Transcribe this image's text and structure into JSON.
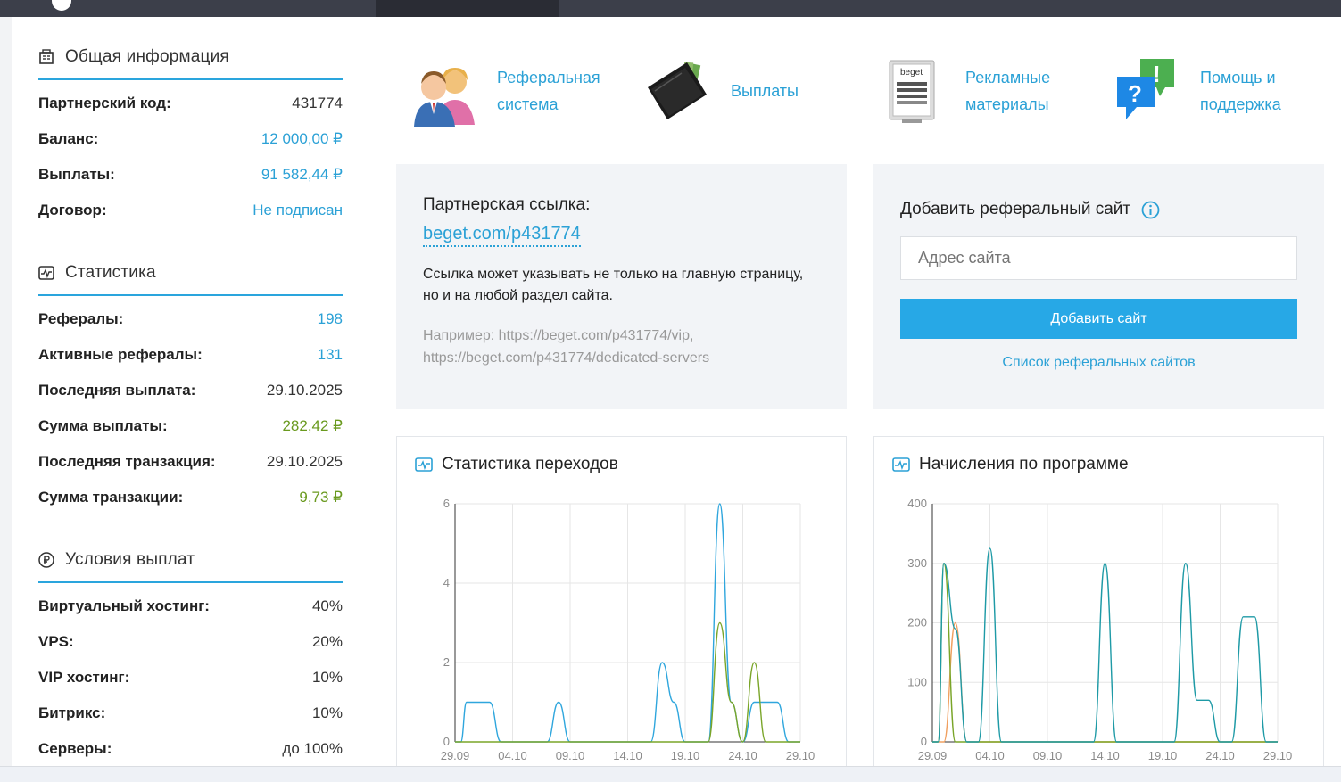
{
  "general": {
    "title": "Общая информация",
    "rows": [
      {
        "label": "Партнерский код:",
        "value": "431774",
        "style": "plain"
      },
      {
        "label": "Баланс:",
        "value": "12 000,00 ₽",
        "style": "blue"
      },
      {
        "label": "Выплаты:",
        "value": "91 582,44 ₽",
        "style": "blue"
      },
      {
        "label": "Договор:",
        "value": "Не подписан",
        "style": "blue"
      }
    ]
  },
  "stats": {
    "title": "Статистика",
    "rows": [
      {
        "label": "Рефералы:",
        "value": "198",
        "style": "blue"
      },
      {
        "label": "Активные рефералы:",
        "value": "131",
        "style": "blue"
      },
      {
        "label": "Последняя выплата:",
        "value": "29.10.2025",
        "style": "plain"
      },
      {
        "label": "Сумма выплаты:",
        "value": "282,42 ₽",
        "style": "green"
      },
      {
        "label": "Последняя транзакция:",
        "value": "29.10.2025",
        "style": "plain"
      },
      {
        "label": "Сумма транзакции:",
        "value": "9,73 ₽",
        "style": "green"
      }
    ]
  },
  "payout": {
    "title": "Условия выплат",
    "rows": [
      {
        "label": "Виртуальный хостинг:",
        "value": "40%",
        "style": "plain"
      },
      {
        "label": "VPS:",
        "value": "20%",
        "style": "plain"
      },
      {
        "label": "VIP хостинг:",
        "value": "10%",
        "style": "plain"
      },
      {
        "label": "Битрикс:",
        "value": "10%",
        "style": "plain"
      },
      {
        "label": "Серверы:",
        "value": "до 100%",
        "style": "plain"
      }
    ]
  },
  "quicklinks": [
    {
      "line1": "Реферальная",
      "line2": "система",
      "icon": "referral-users-icon"
    },
    {
      "line1": "Выплаты",
      "line2": "",
      "icon": "wallet-icon"
    },
    {
      "line1": "Рекламные",
      "line2": "материалы",
      "icon": "banner-icon"
    },
    {
      "line1": "Помощь и",
      "line2": "поддержка",
      "icon": "help-bubble-icon"
    }
  ],
  "referral": {
    "title": "Партнерская ссылка:",
    "link": "beget.com/p431774",
    "desc_line1": "Ссылка может указывать не только на главную страницу,",
    "desc_line2": "но и на любой раздел сайта.",
    "example_line1": "Например: https://beget.com/p431774/vip,",
    "example_line2": "https://beget.com/p431774/dedicated-servers"
  },
  "add_site": {
    "title": "Добавить реферальный сайт",
    "placeholder": "Адрес сайта",
    "button": "Добавить сайт",
    "list_link": "Список реферальных сайтов"
  },
  "banner_logo_text": "beget",
  "colors": {
    "accent": "#27a8e6",
    "link": "#2ba1d6",
    "green": "#6a9a1f",
    "series_blue": "#2fa6dd",
    "series_green": "#7aa529",
    "series_orange": "#f0a060",
    "series_teal": "#1e9aa6"
  },
  "chart_data": [
    {
      "type": "line",
      "title": "Статистика переходов",
      "x_ticks": [
        "29.09",
        "04.10",
        "09.10",
        "14.10",
        "19.10",
        "24.10",
        "29.10"
      ],
      "ylim": [
        0,
        6
      ],
      "y_ticks": [
        0,
        2,
        4,
        6
      ],
      "grid": true,
      "series": [
        {
          "color": "series_blue",
          "points": [
            [
              0,
              0
            ],
            [
              0.5,
              0
            ],
            [
              1,
              1
            ],
            [
              2,
              1
            ],
            [
              3,
              1
            ],
            [
              4,
              0
            ],
            [
              8,
              0
            ],
            [
              9,
              1
            ],
            [
              10,
              0
            ],
            [
              16,
              0
            ],
            [
              17,
              0
            ],
            [
              18,
              2
            ],
            [
              19,
              1
            ],
            [
              20,
              0
            ],
            [
              21,
              0
            ],
            [
              22,
              0
            ],
            [
              23,
              6
            ],
            [
              24,
              1
            ],
            [
              25,
              0
            ],
            [
              26,
              1
            ],
            [
              27,
              1
            ],
            [
              28,
              1
            ],
            [
              29,
              0
            ],
            [
              30,
              0
            ]
          ]
        },
        {
          "color": "series_green",
          "points": [
            [
              0,
              0
            ],
            [
              21,
              0
            ],
            [
              22,
              0
            ],
            [
              23,
              3
            ],
            [
              24,
              1
            ],
            [
              25,
              0
            ],
            [
              26,
              2
            ],
            [
              27,
              0
            ],
            [
              28,
              0
            ],
            [
              30,
              0
            ]
          ]
        }
      ]
    },
    {
      "type": "line",
      "title": "Начисления по программе",
      "x_ticks": [
        "29.09",
        "04.10",
        "09.10",
        "14.10",
        "19.10",
        "24.10",
        "29.10"
      ],
      "ylim": [
        0,
        400
      ],
      "y_ticks": [
        0,
        100,
        200,
        300,
        400
      ],
      "grid": true,
      "series": [
        {
          "color": "series_orange",
          "points": [
            [
              0,
              0
            ],
            [
              1,
              0
            ],
            [
              2,
              200
            ],
            [
              3,
              0
            ],
            [
              30,
              0
            ]
          ]
        },
        {
          "color": "series_green",
          "points": [
            [
              0,
              0
            ],
            [
              0.5,
              0
            ],
            [
              1,
              300
            ],
            [
              2,
              0
            ],
            [
              30,
              0
            ]
          ]
        },
        {
          "color": "series_teal",
          "points": [
            [
              0,
              0
            ],
            [
              0.5,
              0
            ],
            [
              1,
              300
            ],
            [
              2,
              190
            ],
            [
              3,
              0
            ],
            [
              4,
              0
            ],
            [
              5,
              325
            ],
            [
              6,
              0
            ],
            [
              14,
              0
            ],
            [
              15,
              300
            ],
            [
              16,
              0
            ],
            [
              21,
              0
            ],
            [
              22,
              300
            ],
            [
              23,
              70
            ],
            [
              24,
              70
            ],
            [
              25,
              0
            ],
            [
              26,
              0
            ],
            [
              27,
              210
            ],
            [
              28,
              210
            ],
            [
              29,
              0
            ],
            [
              30,
              0
            ]
          ]
        }
      ]
    }
  ]
}
